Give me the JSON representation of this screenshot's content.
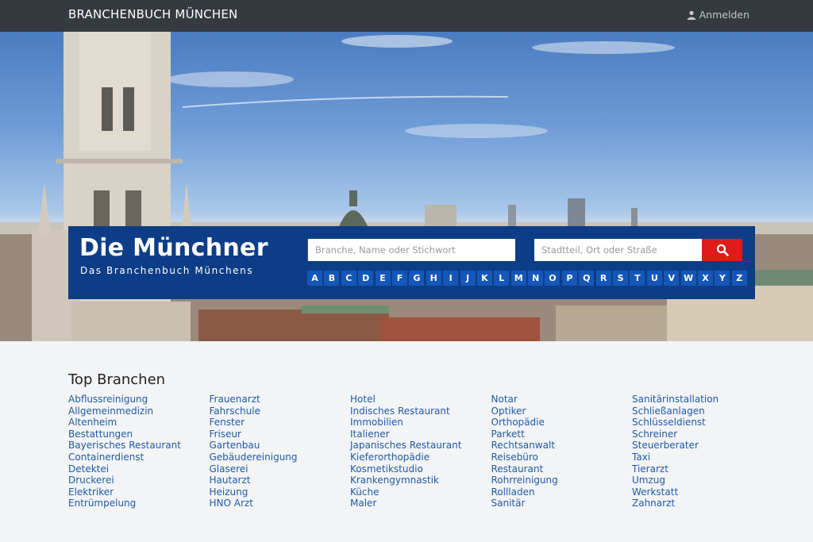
{
  "navbar": {
    "brand": "BRANCHENBUCH MÜNCHEN",
    "login_label": "Anmelden",
    "login_icon": "user-icon"
  },
  "hero": {
    "logo_title": "Die Münchner",
    "logo_subtitle": "Das Branchenbuch Münchens",
    "search": {
      "what_placeholder": "Branche, Name oder Stichwort",
      "what_value": "",
      "where_placeholder": "Stadtteil, Ort oder Straße",
      "where_value": "",
      "button_icon": "search-icon",
      "button_color": "#e01b1b"
    },
    "alphabet": [
      "A",
      "B",
      "C",
      "D",
      "E",
      "F",
      "G",
      "H",
      "I",
      "J",
      "K",
      "L",
      "M",
      "N",
      "O",
      "P",
      "Q",
      "R",
      "S",
      "T",
      "U",
      "V",
      "W",
      "X",
      "Y",
      "Z"
    ],
    "panel_color": "#0d3d86",
    "letter_color": "#1457b8"
  },
  "top_branchen": {
    "title": "Top Branchen",
    "columns": [
      [
        "Abflussreinigung",
        "Allgemeinmedizin",
        "Altenheim",
        "Bestattungen",
        "Bayerisches Restaurant",
        "Containerdienst",
        "Detektei",
        "Druckerei",
        "Elektriker",
        "Entrümpelung"
      ],
      [
        "Frauenarzt",
        "Fahrschule",
        "Fenster",
        "Friseur",
        "Gartenbau",
        "Gebäudereinigung",
        "Glaserei",
        "Hautarzt",
        "Heizung",
        "HNO Arzt"
      ],
      [
        "Hotel",
        "Indisches Restaurant",
        "Immobilien",
        "Italiener",
        "Japanisches Restaurant",
        "Kieferorthopädie",
        "Kosmetikstudio",
        "Krankengymnastik",
        "Küche",
        "Maler"
      ],
      [
        "Notar",
        "Optiker",
        "Orthopädie",
        "Parkett",
        "Rechtsanwalt",
        "Reisebüro",
        "Restaurant",
        "Rohrreinigung",
        "Rollladen",
        "Sanitär"
      ],
      [
        "Sanitärinstallation",
        "Schließanlagen",
        "Schlüsseldienst",
        "Schreiner",
        "Steuerberater",
        "Taxi",
        "Tierarzt",
        "Umzug",
        "Werkstatt",
        "Zahnarzt"
      ]
    ],
    "link_color": "#1f5aa6"
  }
}
